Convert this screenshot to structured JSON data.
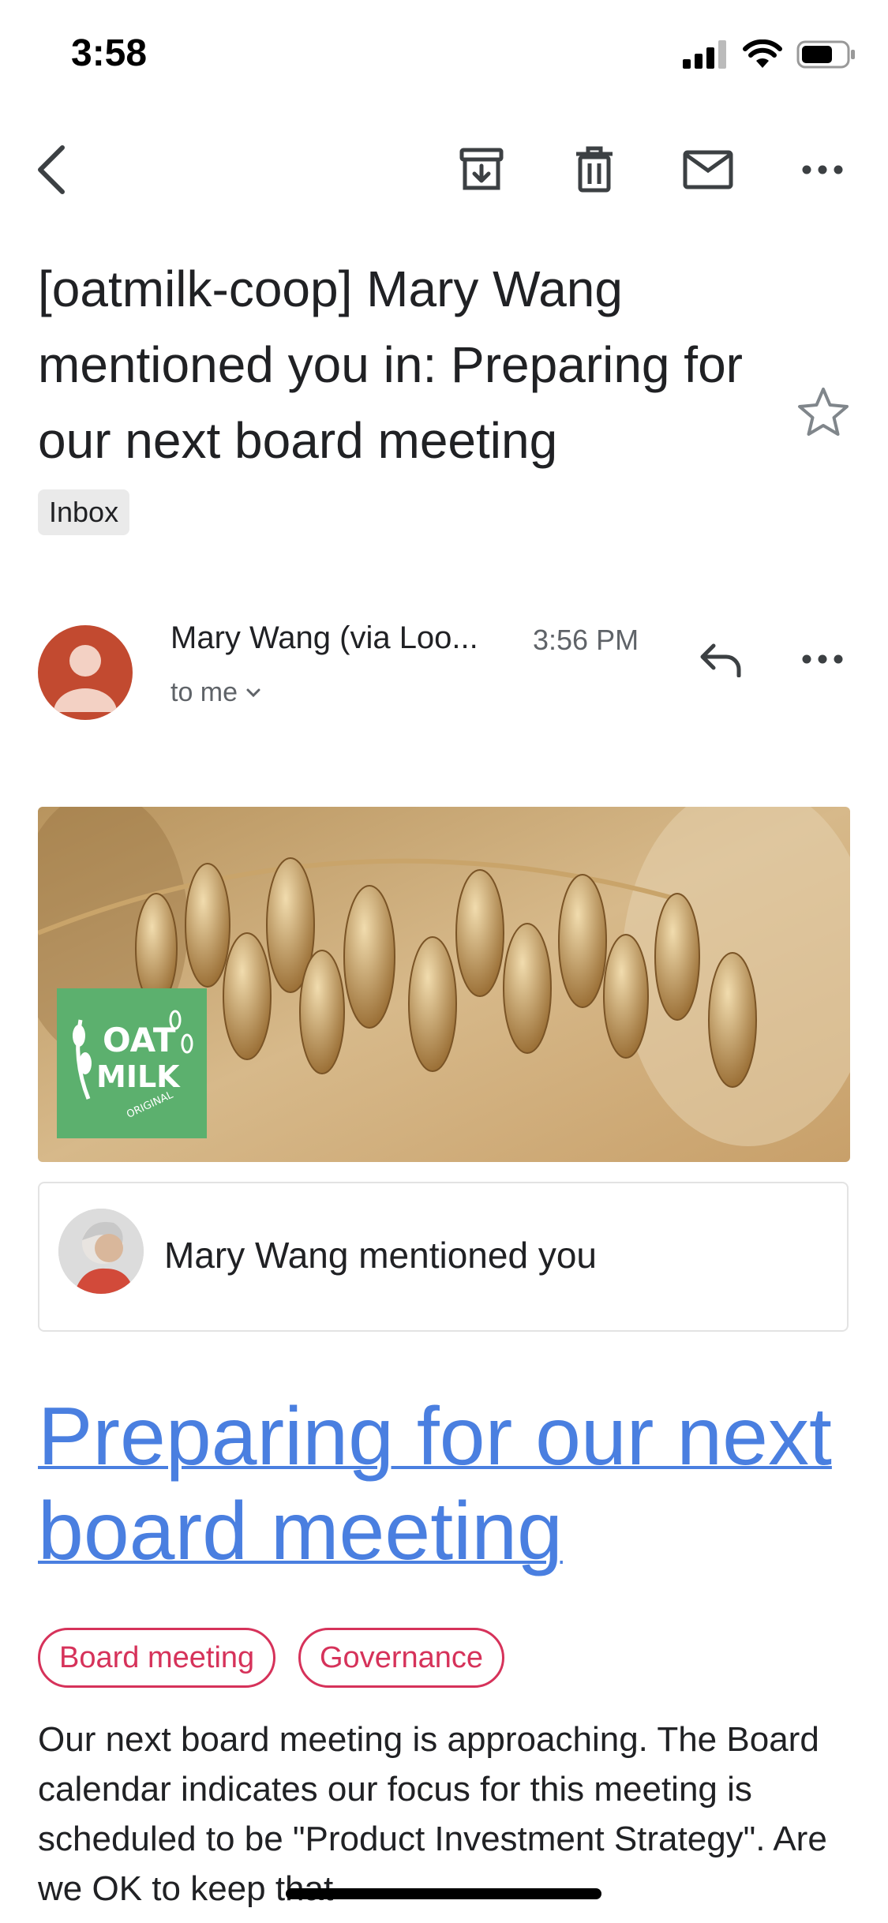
{
  "status_bar": {
    "time": "3:58"
  },
  "email": {
    "subject": "[oatmilk-coop] Mary Wang mentioned you in: Preparing for our next board meeting",
    "label": "Inbox",
    "sender": {
      "name": "Mary Wang (via Loo...",
      "time": "3:56 PM",
      "recipient": "to me"
    }
  },
  "content": {
    "mention_text": "Mary Wang mentioned you",
    "doc_title": "Preparing for our next board meeting",
    "tags": [
      "Board meeting",
      "Governance"
    ],
    "body": "Our next board meeting is approaching. The Board calendar indicates our focus for this meeting is scheduled to be \"Product Investment Strategy\". Are we OK to keep that",
    "logo_text": [
      "OAT",
      "MILK",
      "ORIGINAL"
    ]
  },
  "colors": {
    "link": "#4a7fe0",
    "tag": "#d6325a",
    "avatar": "#c24a30",
    "logo_bg": "#5cb06e"
  }
}
